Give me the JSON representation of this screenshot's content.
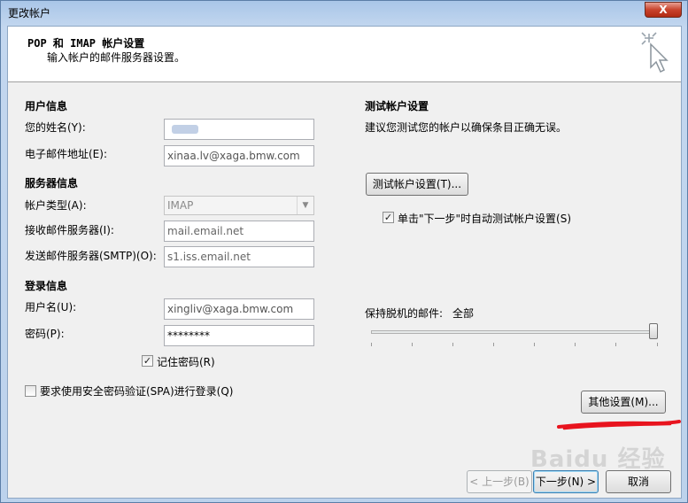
{
  "window": {
    "title": "更改帐户",
    "close_glyph": "X"
  },
  "header": {
    "title": "POP 和 IMAP 帐户设置",
    "subtitle": "输入帐户的邮件服务器设置。",
    "icon": "cursor-sparkle-icon"
  },
  "user_info": {
    "title": "用户信息",
    "name_label": "您的姓名(Y):",
    "name_value": "",
    "email_label": "电子邮件地址(E):",
    "email_value": "xinaa.lv@xaga.bmw.com"
  },
  "server_info": {
    "title": "服务器信息",
    "account_type_label": "帐户类型(A):",
    "account_type_value": "IMAP",
    "incoming_label": "接收邮件服务器(I):",
    "incoming_value": "mail.email.net",
    "outgoing_label": "发送邮件服务器(SMTP)(O):",
    "outgoing_value": "s1.iss.email.net"
  },
  "login_info": {
    "title": "登录信息",
    "username_label": "用户名(U):",
    "username_value": "xingliv@xaga.bmw.com",
    "password_label": "密码(P):",
    "password_value": "********",
    "remember_label": "记住密码(R)",
    "remember_checked": "✓",
    "spa_label": "要求使用安全密码验证(SPA)进行登录(Q)"
  },
  "test": {
    "title": "测试帐户设置",
    "description": "建议您测试您的帐户以确保条目正确无误。",
    "test_button": "测试帐户设置(T)...",
    "auto_test_label": "单击\"下一步\"时自动测试帐户设置(S)",
    "auto_test_checked": "✓"
  },
  "offline": {
    "label": "保持脱机的邮件:",
    "value": "全部",
    "level_fraction": 1.0
  },
  "buttons": {
    "more_settings": "其他设置(M)...",
    "back": "< 上一步(B)",
    "next": "下一步(N) >",
    "cancel": "取消"
  },
  "watermark": {
    "text": "Baidu 经验"
  },
  "colors": {
    "accent_red": "#e8141e"
  }
}
